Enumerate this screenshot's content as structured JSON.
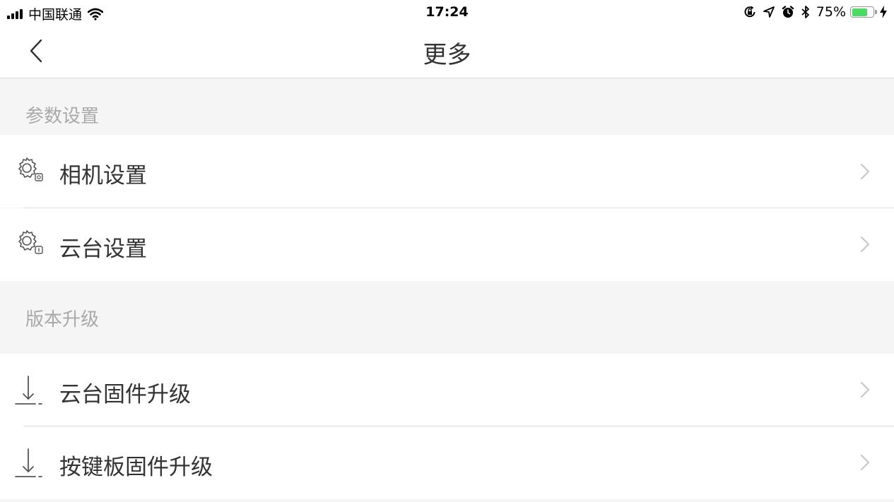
{
  "status_bar": {
    "carrier": "中国联通",
    "time": "17:24",
    "battery_percent": "75%",
    "battery_level": 0.75,
    "icons": [
      "signal-icon",
      "wifi-icon",
      "orientation-lock-icon",
      "location-icon",
      "alarm-icon",
      "bluetooth-icon",
      "battery-icon",
      "charging-icon"
    ]
  },
  "nav": {
    "title": "更多",
    "back_icon": "chevron-left-icon"
  },
  "sections": [
    {
      "header": "参数设置",
      "items": [
        {
          "label": "相机设置",
          "icon": "gear-camera-icon"
        },
        {
          "label": "云台设置",
          "icon": "gear-gimbal-icon"
        }
      ]
    },
    {
      "header": "版本升级",
      "items": [
        {
          "label": "云台固件升级",
          "icon": "download-icon"
        },
        {
          "label": "按键板固件升级",
          "icon": "download-icon"
        }
      ]
    }
  ],
  "colors": {
    "background": "#f5f5f5",
    "row_background": "#ffffff",
    "header_text": "#a9a9a9",
    "label_text": "#333333",
    "chevron": "#c7c7cc",
    "battery_fill": "#4cd964"
  }
}
